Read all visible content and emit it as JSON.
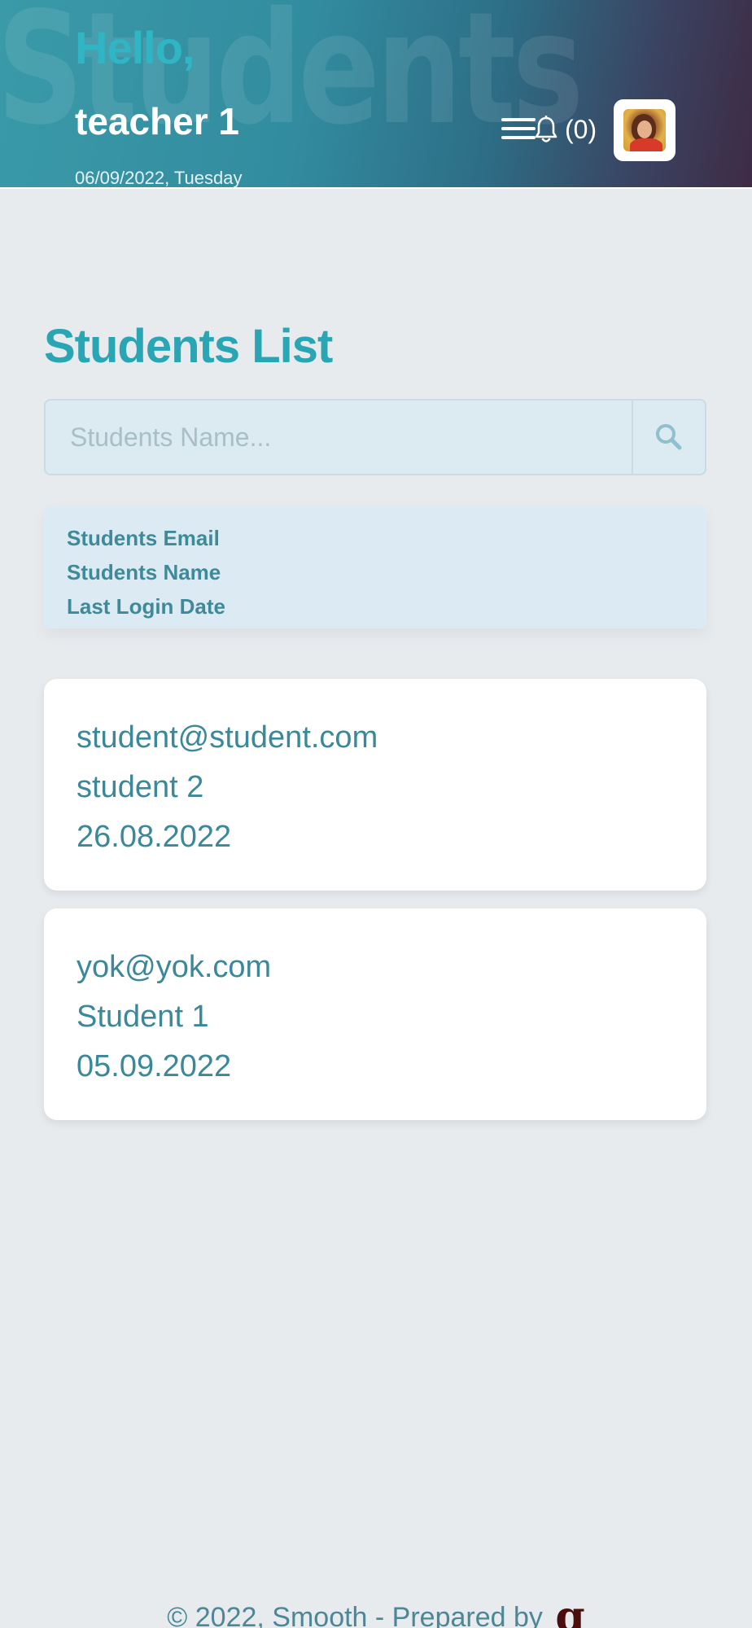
{
  "header": {
    "watermark": "Students",
    "greeting": "Hello,",
    "username": "teacher 1",
    "date": "06/09/2022, Tuesday",
    "notifications_label": "(0)"
  },
  "page": {
    "title": "Students List"
  },
  "search": {
    "placeholder": "Students Name...",
    "value": ""
  },
  "sort_options": [
    {
      "label": "Students Email"
    },
    {
      "label": "Students Name"
    },
    {
      "label": "Last Login Date"
    }
  ],
  "students": [
    {
      "email": "student@student.com",
      "name": "student 2",
      "last_login": "26.08.2022"
    },
    {
      "email": "yok@yok.com",
      "name": "Student 1",
      "last_login": "05.09.2022"
    }
  ],
  "footer": {
    "text": "© 2022, Smooth - Prepared by",
    "logo_glyph": "g"
  },
  "colors": {
    "accent": "#2aa5b3",
    "text_teal": "#3a8898",
    "background": "#e7ebee"
  },
  "icons": [
    "menu-icon",
    "bell-icon",
    "search-icon"
  ]
}
